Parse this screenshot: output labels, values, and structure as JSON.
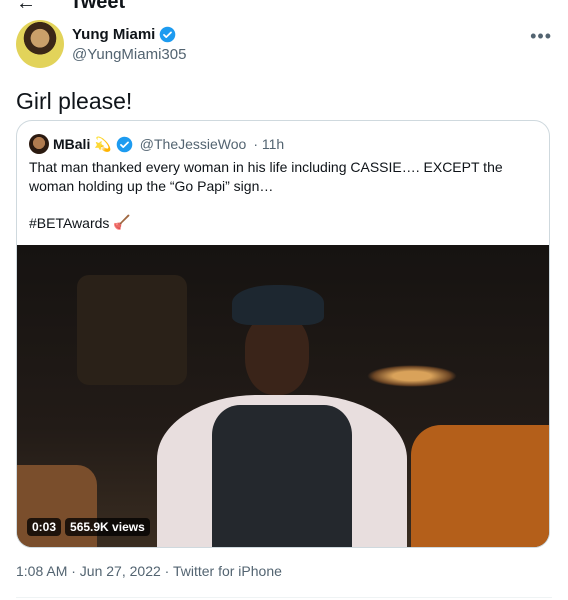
{
  "header": {
    "title": "Tweet"
  },
  "tweet": {
    "author_name": "Yung Miami",
    "author_handle": "@YungMiami305",
    "text": "Girl please!",
    "timestamp": "1:08 AM · Jun 27, 2022 · Twitter for iPhone"
  },
  "quote": {
    "author_name": "MBali",
    "author_emoji": "💫",
    "author_handle": "@TheJessieWoo",
    "time": "· 11h",
    "text": "That man thanked every woman in his life including CASSIE…. EXCEPT the woman holding up the “Go Papi” sign…",
    "hashtag": "#BETAwards",
    "hashtag_emoji": "🪠"
  },
  "video": {
    "duration": "0:03",
    "views": "565.9K views"
  },
  "colors": {
    "verified": "#1d9bf0",
    "secondary_text": "#536471",
    "border": "#cfd9de"
  }
}
